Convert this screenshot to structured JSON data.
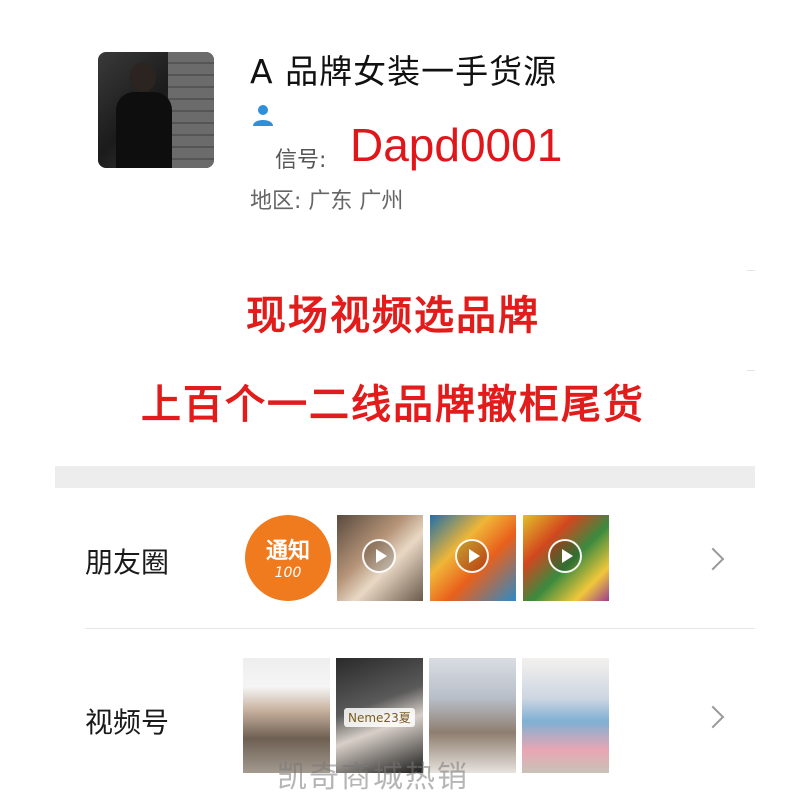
{
  "profile": {
    "name": "A 品牌女装一手货源",
    "wechat_label": "信号:",
    "wechat_id": "Dapd0001",
    "region_label": "地区:",
    "region_value": "广东  广州"
  },
  "slogan": {
    "line1": "现场视频选品牌",
    "line2": "上百个一二线品牌撤柜尾货"
  },
  "moments": {
    "label": "朋友圈",
    "notice_text": "通知",
    "notice_number": "100"
  },
  "channels": {
    "label": "视频号",
    "thumb_tag": "Neme23夏"
  },
  "watermark": "凯奇商城热销",
  "colors": {
    "accent_red": "#e21b1b",
    "notice_orange": "#f07a1e"
  }
}
